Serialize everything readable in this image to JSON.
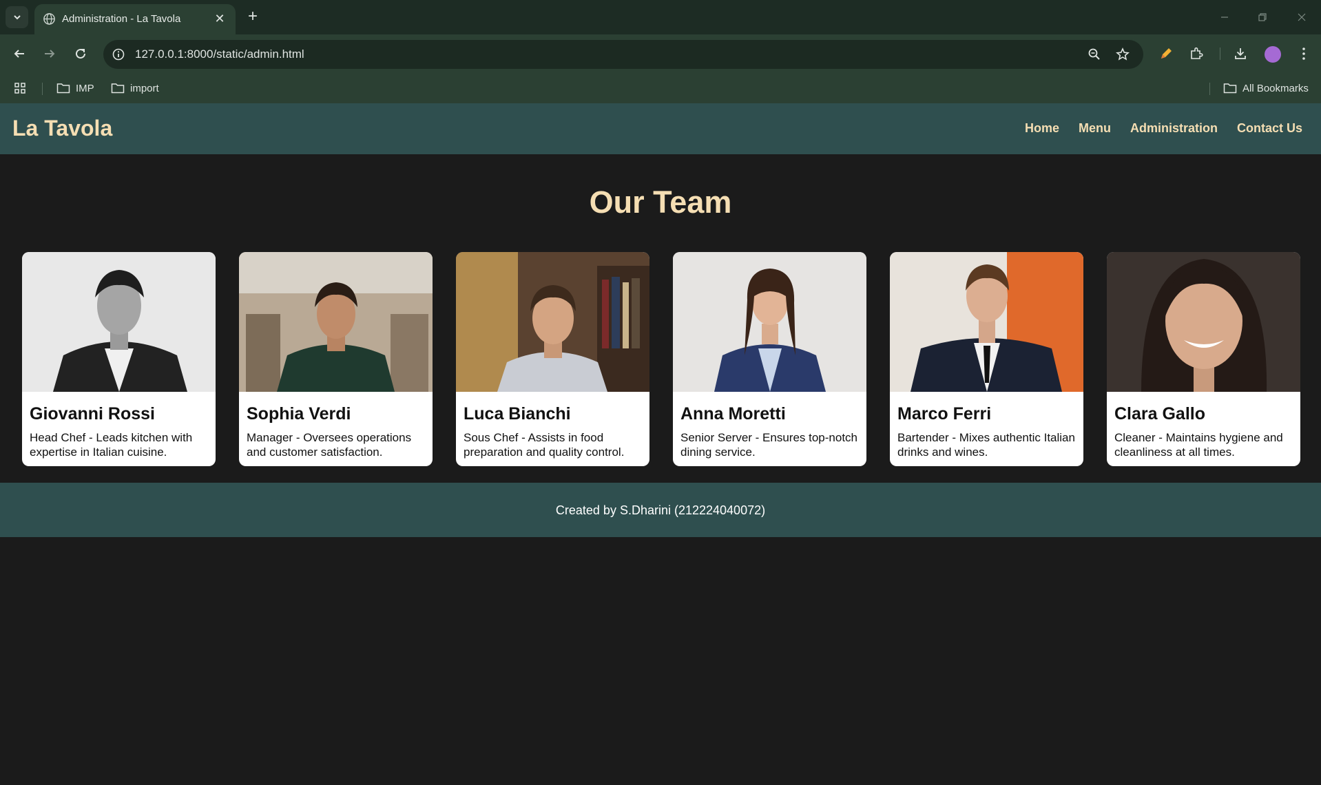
{
  "browser": {
    "tab_title": "Administration - La Tavola",
    "url": "127.0.0.1:8000/static/admin.html",
    "bookmarks": [
      "IMP",
      "import"
    ],
    "all_bookmarks_label": "All Bookmarks"
  },
  "site": {
    "brand": "La Tavola",
    "nav": [
      "Home",
      "Menu",
      "Administration",
      "Contact Us"
    ],
    "section_title": "Our Team",
    "team": [
      {
        "name": "Giovanni Rossi",
        "description": "Head Chef - Leads kitchen with expertise in Italian cuisine."
      },
      {
        "name": "Sophia Verdi",
        "description": "Manager - Oversees operations and customer satisfaction."
      },
      {
        "name": "Luca Bianchi",
        "description": "Sous Chef - Assists in food preparation and quality control."
      },
      {
        "name": "Anna Moretti",
        "description": "Senior Server - Ensures top-notch dining service."
      },
      {
        "name": "Marco Ferri",
        "description": "Bartender - Mixes authentic Italian drinks and wines."
      },
      {
        "name": "Clara Gallo",
        "description": "Cleaner - Maintains hygiene and cleanliness at all times."
      }
    ],
    "footer": "Created by S.Dharini (212224040072)"
  },
  "colors": {
    "header_bg": "#2f4f4f",
    "accent_text": "#f5deb3",
    "page_bg": "#1b1b1b"
  }
}
